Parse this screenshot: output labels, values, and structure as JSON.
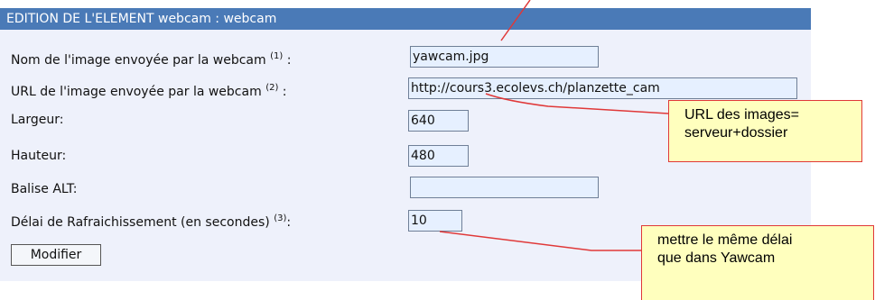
{
  "header": {
    "title": "EDITION DE L'ELEMENT webcam : webcam"
  },
  "fields": [
    {
      "label": "Nom de l'image envoyée par la webcam",
      "note": "(1)",
      "suffix": " :",
      "value": "yawcam.jpg"
    },
    {
      "label": "URL de l'image envoyée par la webcam",
      "note": "(2)",
      "suffix": " :",
      "value": "http://cours3.ecolevs.ch/planzette_cam"
    },
    {
      "label": "Largeur:",
      "value": "640"
    },
    {
      "label": "Hauteur:",
      "value": "480"
    },
    {
      "label": "Balise ALT:",
      "value": ""
    },
    {
      "label": "Délai de Rafraichissement (en secondes) ",
      "note": "(3)",
      "suffix": ":",
      "value": "10"
    }
  ],
  "buttons": {
    "submit": "Modifier"
  },
  "annotations": {
    "url_callout": "URL des images=\nserveur+dossier",
    "delay_callout": "mettre le même délai\nque dans Yawcam"
  },
  "colors": {
    "header_bg": "#4a7ab7",
    "panel_bg": "#eef1fb",
    "input_bg": "#e6f0ff",
    "callout_bg": "#ffffbe",
    "annotation_line": "#e03838"
  }
}
